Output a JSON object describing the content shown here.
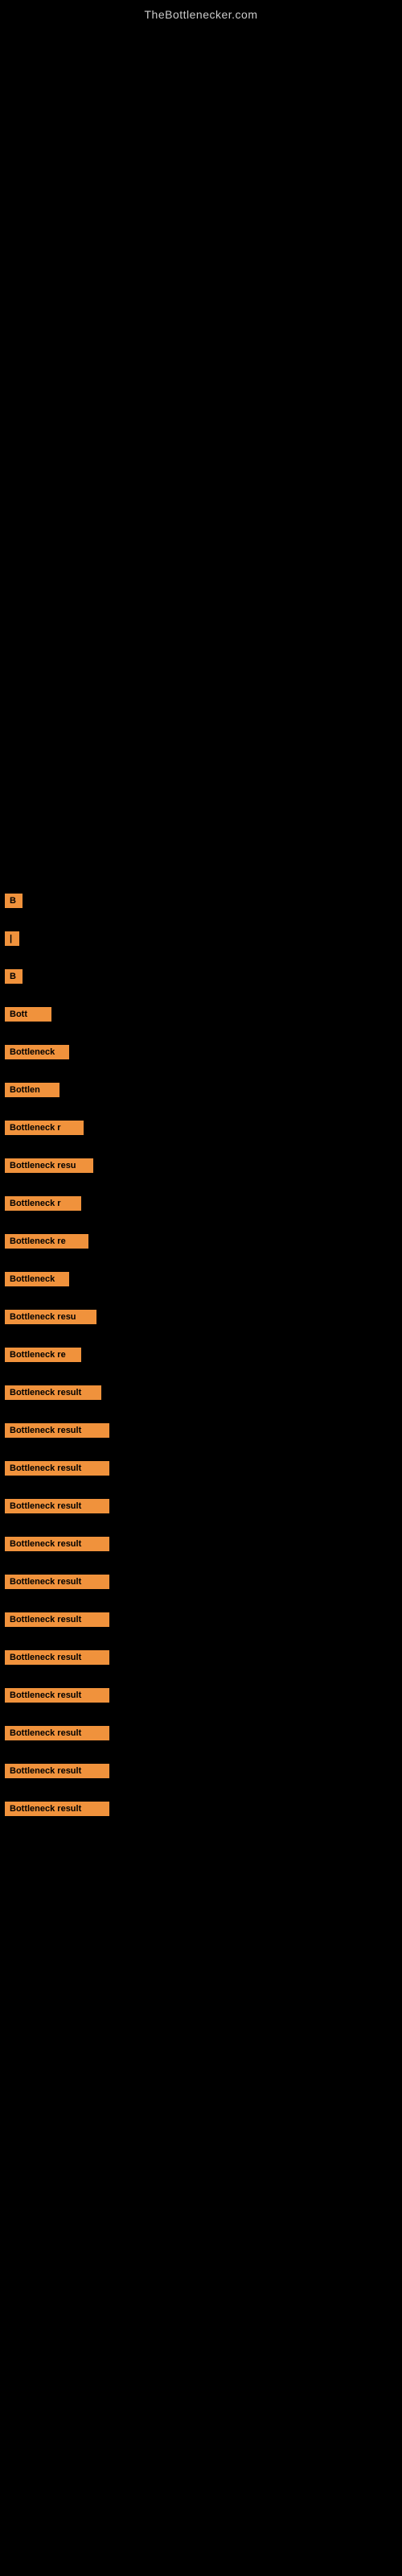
{
  "header": {
    "title": "TheBottlenecker.com"
  },
  "items": [
    {
      "id": 1,
      "label": "B",
      "width_class": "item-w1"
    },
    {
      "id": 2,
      "label": "|",
      "width_class": "item-w2"
    },
    {
      "id": 3,
      "label": "B",
      "width_class": "item-w3"
    },
    {
      "id": 4,
      "label": "Bott",
      "width_class": "item-w4"
    },
    {
      "id": 5,
      "label": "Bottleneck",
      "width_class": "item-w5"
    },
    {
      "id": 6,
      "label": "Bottlen",
      "width_class": "item-w6"
    },
    {
      "id": 7,
      "label": "Bottleneck r",
      "width_class": "item-w7"
    },
    {
      "id": 8,
      "label": "Bottleneck resu",
      "width_class": "item-w8"
    },
    {
      "id": 9,
      "label": "Bottleneck r",
      "width_class": "item-w9"
    },
    {
      "id": 10,
      "label": "Bottleneck re",
      "width_class": "item-w10"
    },
    {
      "id": 11,
      "label": "Bottleneck",
      "width_class": "item-w11"
    },
    {
      "id": 12,
      "label": "Bottleneck resu",
      "width_class": "item-w12"
    },
    {
      "id": 13,
      "label": "Bottleneck re",
      "width_class": "item-w13"
    },
    {
      "id": 14,
      "label": "Bottleneck result",
      "width_class": "item-w14"
    },
    {
      "id": 15,
      "label": "Bottleneck result",
      "width_class": "item-w15"
    },
    {
      "id": 16,
      "label": "Bottleneck result",
      "width_class": "item-w16"
    },
    {
      "id": 17,
      "label": "Bottleneck result",
      "width_class": "item-w17"
    },
    {
      "id": 18,
      "label": "Bottleneck result",
      "width_class": "item-w18"
    },
    {
      "id": 19,
      "label": "Bottleneck result",
      "width_class": "item-w19"
    },
    {
      "id": 20,
      "label": "Bottleneck result",
      "width_class": "item-w20"
    },
    {
      "id": 21,
      "label": "Bottleneck result",
      "width_class": "item-w21"
    },
    {
      "id": 22,
      "label": "Bottleneck result",
      "width_class": "item-w22"
    },
    {
      "id": 23,
      "label": "Bottleneck result",
      "width_class": "item-w23"
    },
    {
      "id": 24,
      "label": "Bottleneck result",
      "width_class": "item-w24"
    },
    {
      "id": 25,
      "label": "Bottleneck result",
      "width_class": "item-w25"
    }
  ]
}
